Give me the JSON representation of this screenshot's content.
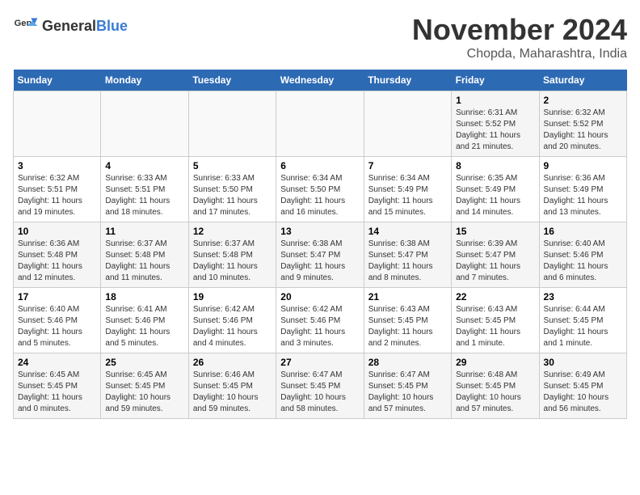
{
  "logo": {
    "text_general": "General",
    "text_blue": "Blue"
  },
  "header": {
    "month_year": "November 2024",
    "location": "Chopda, Maharashtra, India"
  },
  "weekdays": [
    "Sunday",
    "Monday",
    "Tuesday",
    "Wednesday",
    "Thursday",
    "Friday",
    "Saturday"
  ],
  "weeks": [
    [
      {
        "day": "",
        "info": ""
      },
      {
        "day": "",
        "info": ""
      },
      {
        "day": "",
        "info": ""
      },
      {
        "day": "",
        "info": ""
      },
      {
        "day": "",
        "info": ""
      },
      {
        "day": "1",
        "info": "Sunrise: 6:31 AM\nSunset: 5:52 PM\nDaylight: 11 hours and 21 minutes."
      },
      {
        "day": "2",
        "info": "Sunrise: 6:32 AM\nSunset: 5:52 PM\nDaylight: 11 hours and 20 minutes."
      }
    ],
    [
      {
        "day": "3",
        "info": "Sunrise: 6:32 AM\nSunset: 5:51 PM\nDaylight: 11 hours and 19 minutes."
      },
      {
        "day": "4",
        "info": "Sunrise: 6:33 AM\nSunset: 5:51 PM\nDaylight: 11 hours and 18 minutes."
      },
      {
        "day": "5",
        "info": "Sunrise: 6:33 AM\nSunset: 5:50 PM\nDaylight: 11 hours and 17 minutes."
      },
      {
        "day": "6",
        "info": "Sunrise: 6:34 AM\nSunset: 5:50 PM\nDaylight: 11 hours and 16 minutes."
      },
      {
        "day": "7",
        "info": "Sunrise: 6:34 AM\nSunset: 5:49 PM\nDaylight: 11 hours and 15 minutes."
      },
      {
        "day": "8",
        "info": "Sunrise: 6:35 AM\nSunset: 5:49 PM\nDaylight: 11 hours and 14 minutes."
      },
      {
        "day": "9",
        "info": "Sunrise: 6:36 AM\nSunset: 5:49 PM\nDaylight: 11 hours and 13 minutes."
      }
    ],
    [
      {
        "day": "10",
        "info": "Sunrise: 6:36 AM\nSunset: 5:48 PM\nDaylight: 11 hours and 12 minutes."
      },
      {
        "day": "11",
        "info": "Sunrise: 6:37 AM\nSunset: 5:48 PM\nDaylight: 11 hours and 11 minutes."
      },
      {
        "day": "12",
        "info": "Sunrise: 6:37 AM\nSunset: 5:48 PM\nDaylight: 11 hours and 10 minutes."
      },
      {
        "day": "13",
        "info": "Sunrise: 6:38 AM\nSunset: 5:47 PM\nDaylight: 11 hours and 9 minutes."
      },
      {
        "day": "14",
        "info": "Sunrise: 6:38 AM\nSunset: 5:47 PM\nDaylight: 11 hours and 8 minutes."
      },
      {
        "day": "15",
        "info": "Sunrise: 6:39 AM\nSunset: 5:47 PM\nDaylight: 11 hours and 7 minutes."
      },
      {
        "day": "16",
        "info": "Sunrise: 6:40 AM\nSunset: 5:46 PM\nDaylight: 11 hours and 6 minutes."
      }
    ],
    [
      {
        "day": "17",
        "info": "Sunrise: 6:40 AM\nSunset: 5:46 PM\nDaylight: 11 hours and 5 minutes."
      },
      {
        "day": "18",
        "info": "Sunrise: 6:41 AM\nSunset: 5:46 PM\nDaylight: 11 hours and 5 minutes."
      },
      {
        "day": "19",
        "info": "Sunrise: 6:42 AM\nSunset: 5:46 PM\nDaylight: 11 hours and 4 minutes."
      },
      {
        "day": "20",
        "info": "Sunrise: 6:42 AM\nSunset: 5:46 PM\nDaylight: 11 hours and 3 minutes."
      },
      {
        "day": "21",
        "info": "Sunrise: 6:43 AM\nSunset: 5:45 PM\nDaylight: 11 hours and 2 minutes."
      },
      {
        "day": "22",
        "info": "Sunrise: 6:43 AM\nSunset: 5:45 PM\nDaylight: 11 hours and 1 minute."
      },
      {
        "day": "23",
        "info": "Sunrise: 6:44 AM\nSunset: 5:45 PM\nDaylight: 11 hours and 1 minute."
      }
    ],
    [
      {
        "day": "24",
        "info": "Sunrise: 6:45 AM\nSunset: 5:45 PM\nDaylight: 11 hours and 0 minutes."
      },
      {
        "day": "25",
        "info": "Sunrise: 6:45 AM\nSunset: 5:45 PM\nDaylight: 10 hours and 59 minutes."
      },
      {
        "day": "26",
        "info": "Sunrise: 6:46 AM\nSunset: 5:45 PM\nDaylight: 10 hours and 59 minutes."
      },
      {
        "day": "27",
        "info": "Sunrise: 6:47 AM\nSunset: 5:45 PM\nDaylight: 10 hours and 58 minutes."
      },
      {
        "day": "28",
        "info": "Sunrise: 6:47 AM\nSunset: 5:45 PM\nDaylight: 10 hours and 57 minutes."
      },
      {
        "day": "29",
        "info": "Sunrise: 6:48 AM\nSunset: 5:45 PM\nDaylight: 10 hours and 57 minutes."
      },
      {
        "day": "30",
        "info": "Sunrise: 6:49 AM\nSunset: 5:45 PM\nDaylight: 10 hours and 56 minutes."
      }
    ]
  ]
}
